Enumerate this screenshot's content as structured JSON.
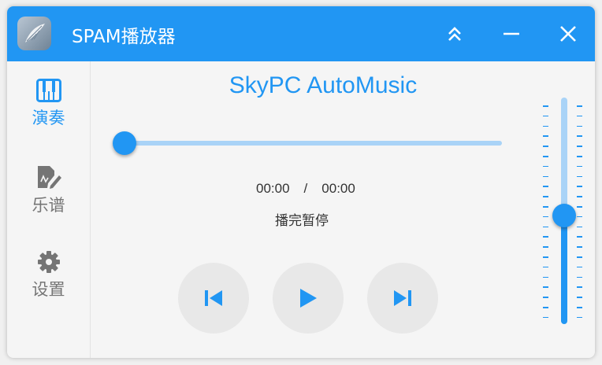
{
  "window": {
    "title": "SPAM播放器"
  },
  "titlebar": {
    "buttons": [
      {
        "name": "collapse",
        "icon": "double-chevron-up-icon"
      },
      {
        "name": "minimize",
        "icon": "minus-icon"
      },
      {
        "name": "close",
        "icon": "close-icon"
      }
    ]
  },
  "sidebar": {
    "items": [
      {
        "label": "演奏",
        "icon": "piano-icon",
        "active": true
      },
      {
        "label": "乐谱",
        "icon": "sheet-edit-icon",
        "active": false
      },
      {
        "label": "设置",
        "icon": "gear-icon",
        "active": false
      }
    ]
  },
  "player": {
    "song_title": "SkyPC AutoMusic",
    "progress": 0,
    "current_time": "00:00",
    "separator": "/",
    "total_time": "00:00",
    "status": "播完暂停"
  },
  "controls": {
    "prev": "skip-previous-icon",
    "play": "play-icon",
    "next": "skip-next-icon"
  },
  "volume": {
    "level": 0.5
  },
  "colors": {
    "accent": "#2196f3",
    "accent_light": "#a9d3f7",
    "inactive": "#757575",
    "button_bg": "#e8e8e8"
  }
}
